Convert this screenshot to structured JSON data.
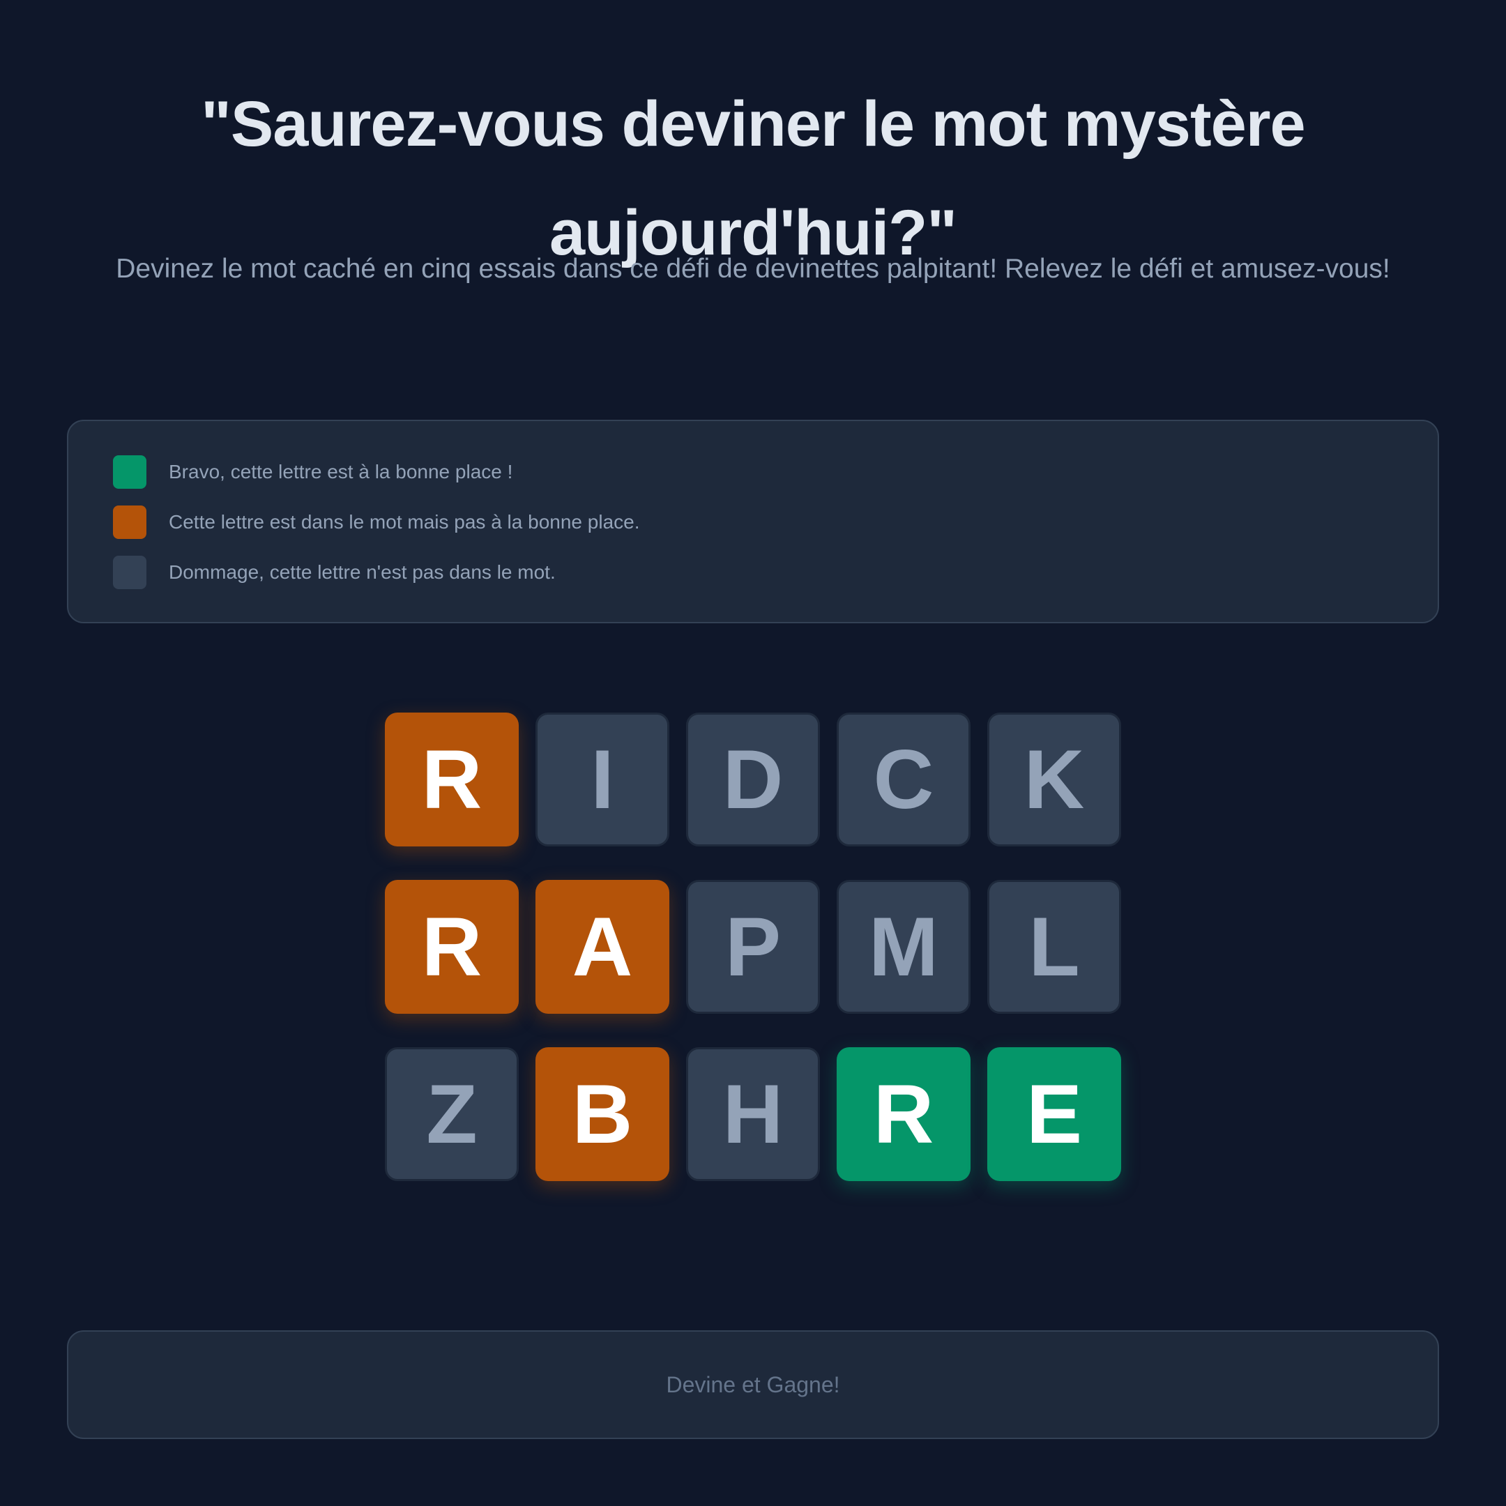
{
  "header": {
    "title": "\"Saurez-vous deviner le mot mystère aujourd'hui?\"",
    "subtitle": "Devinez le mot caché en cinq essais dans ce défi de devinettes palpitant! Relevez le défi et amusez-vous!"
  },
  "legend": {
    "items": [
      {
        "status": "correct",
        "color": "#059669",
        "label": "Bravo, cette lettre est à la bonne place !"
      },
      {
        "status": "present",
        "color": "#b45309",
        "label": "Cette lettre est dans le mot mais pas à la bonne place."
      },
      {
        "status": "absent",
        "color": "#334155",
        "label": "Dommage, cette lettre n'est pas dans le mot."
      }
    ]
  },
  "board": {
    "rows": [
      {
        "tiles": [
          {
            "letter": "R",
            "status": "present"
          },
          {
            "letter": "I",
            "status": "absent"
          },
          {
            "letter": "D",
            "status": "absent"
          },
          {
            "letter": "C",
            "status": "absent"
          },
          {
            "letter": "K",
            "status": "absent"
          }
        ]
      },
      {
        "tiles": [
          {
            "letter": "R",
            "status": "present"
          },
          {
            "letter": "A",
            "status": "present"
          },
          {
            "letter": "P",
            "status": "absent"
          },
          {
            "letter": "M",
            "status": "absent"
          },
          {
            "letter": "L",
            "status": "absent"
          }
        ]
      },
      {
        "tiles": [
          {
            "letter": "Z",
            "status": "absent"
          },
          {
            "letter": "B",
            "status": "present"
          },
          {
            "letter": "H",
            "status": "absent"
          },
          {
            "letter": "R",
            "status": "correct"
          },
          {
            "letter": "E",
            "status": "correct"
          }
        ]
      }
    ]
  },
  "action": {
    "label": "Devine et Gagne!"
  },
  "colors": {
    "background": "#0f172a",
    "panel": "#1e293b",
    "correct": "#059669",
    "present": "#b45309",
    "absent": "#334155"
  }
}
